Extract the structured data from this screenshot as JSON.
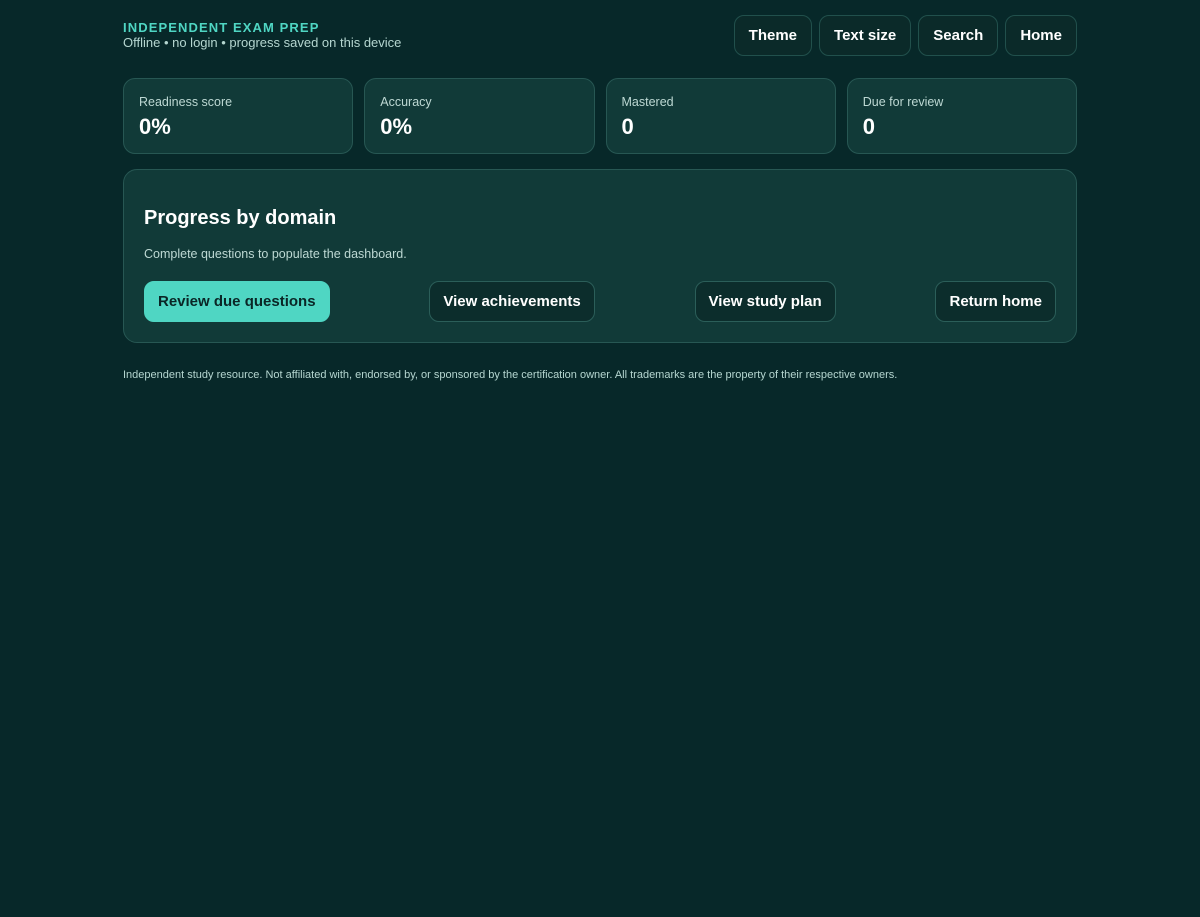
{
  "header": {
    "brand": "INDEPENDENT EXAM PREP",
    "tagline": "Offline • no login • progress saved on this device",
    "nav": [
      "Theme",
      "Text size",
      "Search",
      "Home"
    ]
  },
  "stats": [
    {
      "label": "Readiness score",
      "value": "0%"
    },
    {
      "label": "Accuracy",
      "value": "0%"
    },
    {
      "label": "Mastered",
      "value": "0"
    },
    {
      "label": "Due for review",
      "value": "0"
    }
  ],
  "panel": {
    "title": "Progress by domain",
    "text": "Complete questions to populate the dashboard.",
    "actions": [
      "Review due questions",
      "View achievements",
      "View study plan",
      "Return home"
    ]
  },
  "footer": {
    "note": "Independent study resource. Not affiliated with, endorsed by, or sponsored by the certification owner. All trademarks are the property of their respective owners."
  },
  "colors": {
    "background": "#072829",
    "card": "#113a38",
    "accent": "#4fd6c3"
  }
}
